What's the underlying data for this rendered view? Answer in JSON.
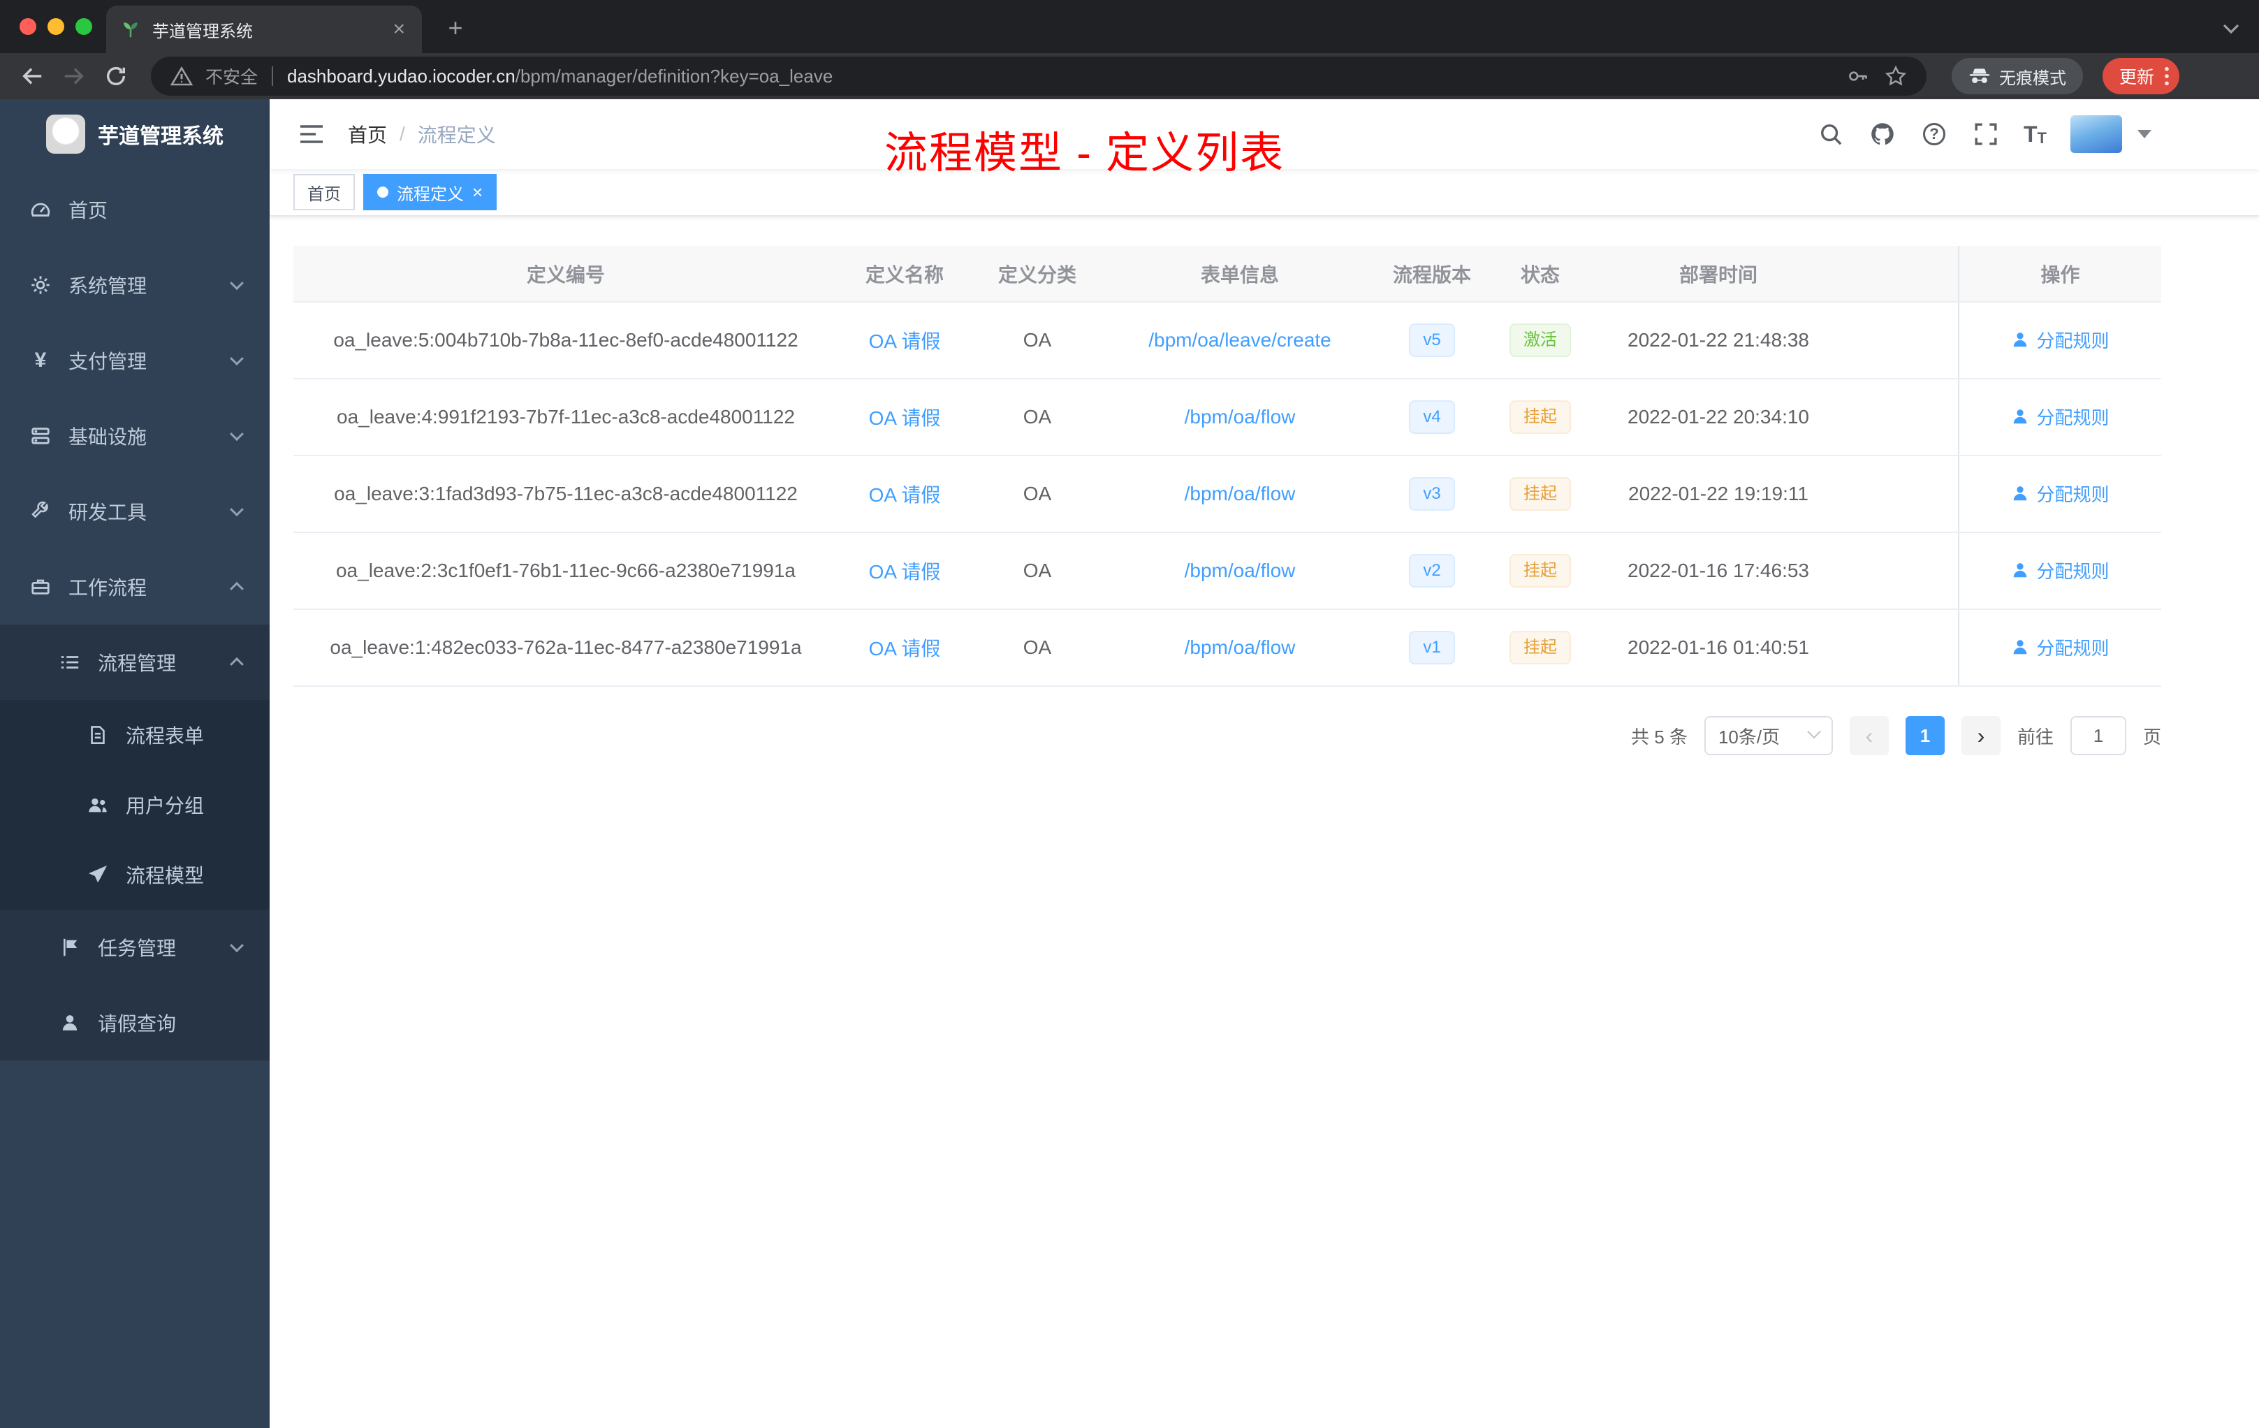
{
  "browser": {
    "tab": {
      "title": "芋道管理系统"
    },
    "address": {
      "security": "不安全",
      "domain": "dashboard.yudao.iocoder.cn",
      "path": "/bpm/manager/definition?key=oa_leave"
    },
    "incognito_label": "无痕模式",
    "update_label": "更新"
  },
  "icons": {
    "tab_close": "×",
    "tag_close": "×",
    "new_tab": "+",
    "currency": "¥",
    "help": "?",
    "font_large": "T",
    "font_small": "T",
    "pager_prev": "‹",
    "pager_next": "›"
  },
  "sidebar": {
    "logo_title": "芋道管理系统",
    "items": [
      {
        "label": "首页",
        "icon": "dashboard-icon"
      },
      {
        "label": "系统管理",
        "icon": "gear-icon"
      },
      {
        "label": "支付管理",
        "icon": "yen-icon"
      },
      {
        "label": "基础设施",
        "icon": "server-icon"
      },
      {
        "label": "研发工具",
        "icon": "wrench-icon"
      },
      {
        "label": "工作流程",
        "icon": "briefcase-icon"
      },
      {
        "label": "流程管理",
        "icon": "list-icon"
      },
      {
        "label": "流程表单",
        "icon": "document-icon"
      },
      {
        "label": "用户分组",
        "icon": "users-icon"
      },
      {
        "label": "流程模型",
        "icon": "paper-plane-icon"
      },
      {
        "label": "任务管理",
        "icon": "flag-icon"
      },
      {
        "label": "请假查询",
        "icon": "user-icon"
      }
    ]
  },
  "navbar": {
    "breadcrumb": {
      "home": "首页",
      "separator": "/",
      "current": "流程定义"
    }
  },
  "annotation": {
    "text": "流程模型 - 定义列表",
    "color": "#ff0000"
  },
  "tags": {
    "items": [
      {
        "label": "首页"
      },
      {
        "label": "流程定义"
      }
    ]
  },
  "table": {
    "columns": {
      "id": "定义编号",
      "name": "定义名称",
      "category": "定义分类",
      "form": "表单信息",
      "version": "流程版本",
      "status": "状态",
      "deploy_time": "部署时间",
      "actions": "操作"
    },
    "rows": [
      {
        "id": "oa_leave:5:004b710b-7b8a-11ec-8ef0-acde48001122",
        "name": "OA 请假",
        "category": "OA",
        "form": "/bpm/oa/leave/create",
        "version": "v5",
        "status": "激活",
        "deploy_time": "2022-01-22 21:48:38",
        "action": "分配规则"
      },
      {
        "id": "oa_leave:4:991f2193-7b7f-11ec-a3c8-acde48001122",
        "name": "OA 请假",
        "category": "OA",
        "form": "/bpm/oa/flow",
        "version": "v4",
        "status": "挂起",
        "deploy_time": "2022-01-22 20:34:10",
        "action": "分配规则"
      },
      {
        "id": "oa_leave:3:1fad3d93-7b75-11ec-a3c8-acde48001122",
        "name": "OA 请假",
        "category": "OA",
        "form": "/bpm/oa/flow",
        "version": "v3",
        "status": "挂起",
        "deploy_time": "2022-01-22 19:19:11",
        "action": "分配规则"
      },
      {
        "id": "oa_leave:2:3c1f0ef1-76b1-11ec-9c66-a2380e71991a",
        "name": "OA 请假",
        "category": "OA",
        "form": "/bpm/oa/flow",
        "version": "v2",
        "status": "挂起",
        "deploy_time": "2022-01-16 17:46:53",
        "action": "分配规则"
      },
      {
        "id": "oa_leave:1:482ec033-762a-11ec-8477-a2380e71991a",
        "name": "OA 请假",
        "category": "OA",
        "form": "/bpm/oa/flow",
        "version": "v1",
        "status": "挂起",
        "deploy_time": "2022-01-16 01:40:51",
        "action": "分配规则"
      }
    ]
  },
  "pagination": {
    "total": "共 5 条",
    "page_size": "10条/页",
    "current_page": "1",
    "goto_label": "前往",
    "goto_value": "1",
    "unit": "页"
  },
  "colors": {
    "accent": "#409eff",
    "success": "#67c23a",
    "warning": "#e6a23c",
    "annotation": "#ff0000"
  }
}
